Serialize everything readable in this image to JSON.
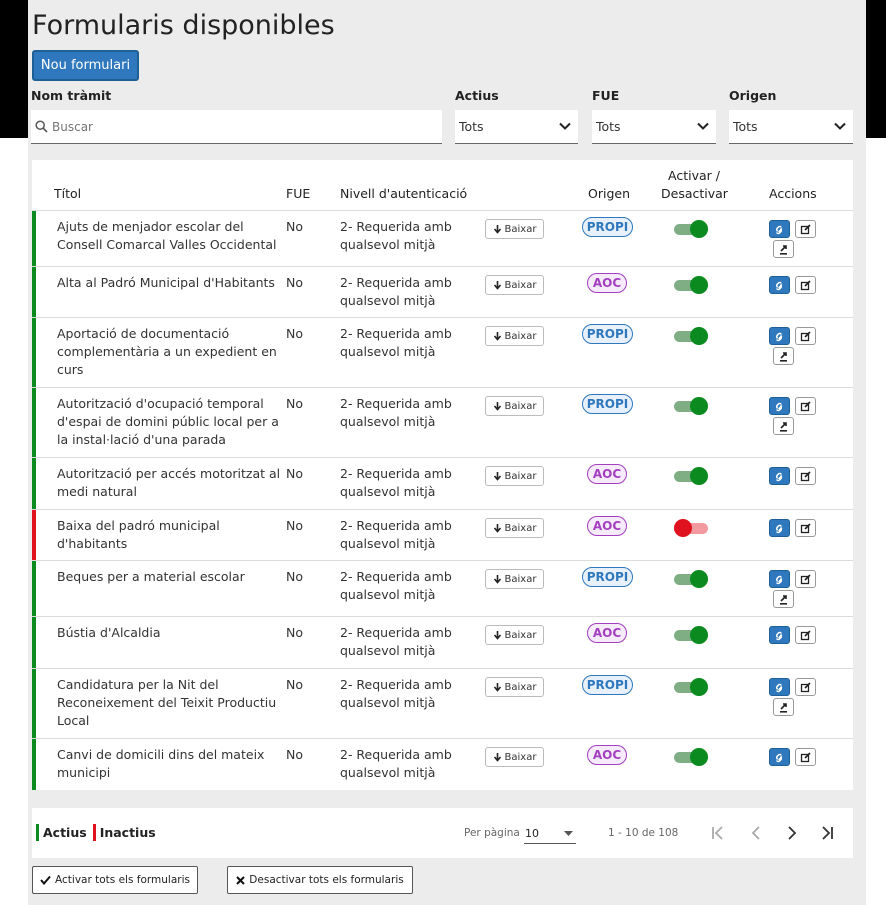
{
  "page": {
    "title": "Formularis disponibles",
    "new_button": "Nou formulari"
  },
  "filters": {
    "name_label": "Nom tràmit",
    "search_placeholder": "Buscar",
    "actius_label": "Actius",
    "actius_value": "Tots",
    "fue_label": "FUE",
    "fue_value": "Tots",
    "origen_label": "Origen",
    "origen_value": "Tots"
  },
  "table": {
    "headers": {
      "titol": "Títol",
      "fue": "FUE",
      "nivell": "Nivell d'autenticació",
      "origen": "Origen",
      "activar_1": "Activar /",
      "activar_2": "Desactivar",
      "accions": "Accions"
    },
    "download_label": "Baixar",
    "rows": [
      {
        "title_lines": [
          "Ajuts de menjador escolar del",
          "Consell Comarcal Valles Occidental"
        ],
        "fue": "No",
        "level_lines": [
          "2- Requerida amb",
          "qualsevol mitjà"
        ],
        "origin": "PROPI",
        "active": true,
        "extra_action": true
      },
      {
        "title_lines": [
          "Alta al Padró Municipal d'Habitants"
        ],
        "fue": "No",
        "level_lines": [
          "2- Requerida amb",
          "qualsevol mitjà"
        ],
        "origin": "AOC",
        "active": true,
        "extra_action": false
      },
      {
        "title_lines": [
          "Aportació de documentació",
          "complementària a un expedient en",
          "curs"
        ],
        "fue": "No",
        "level_lines": [
          "2- Requerida amb",
          "qualsevol mitjà"
        ],
        "origin": "PROPI",
        "active": true,
        "extra_action": true
      },
      {
        "title_lines": [
          "Autorització d'ocupació temporal",
          "d'espai de domini públic local per a",
          "la instal·lació d'una parada"
        ],
        "fue": "No",
        "level_lines": [
          "2- Requerida amb",
          "qualsevol mitjà"
        ],
        "origin": "PROPI",
        "active": true,
        "extra_action": true
      },
      {
        "title_lines": [
          "Autorització per accés motoritzat al",
          "medi natural"
        ],
        "fue": "No",
        "level_lines": [
          "2- Requerida amb",
          "qualsevol mitjà"
        ],
        "origin": "AOC",
        "active": true,
        "extra_action": false
      },
      {
        "title_lines": [
          "Baixa del padró municipal",
          "d'habitants"
        ],
        "fue": "No",
        "level_lines": [
          "2- Requerida amb",
          "qualsevol mitjà"
        ],
        "origin": "AOC",
        "active": false,
        "extra_action": false
      },
      {
        "title_lines": [
          "Beques per a material escolar"
        ],
        "fue": "No",
        "level_lines": [
          "2- Requerida amb",
          "qualsevol mitjà"
        ],
        "origin": "PROPI",
        "active": true,
        "extra_action": true
      },
      {
        "title_lines": [
          "Bústia d'Alcaldia"
        ],
        "fue": "No",
        "level_lines": [
          "2- Requerida amb",
          "qualsevol mitjà"
        ],
        "origin": "AOC",
        "active": true,
        "extra_action": false
      },
      {
        "title_lines": [
          "Candidatura per la Nit del",
          "Reconeixement del Teixit Productiu",
          "Local"
        ],
        "fue": "No",
        "level_lines": [
          "2- Requerida amb",
          "qualsevol mitjà"
        ],
        "origin": "PROPI",
        "active": true,
        "extra_action": true
      },
      {
        "title_lines": [
          "Canvi de domicili dins del mateix",
          "municipi"
        ],
        "fue": "No",
        "level_lines": [
          "2- Requerida amb",
          "qualsevol mitjà"
        ],
        "origin": "AOC",
        "active": true,
        "extra_action": false
      }
    ]
  },
  "footer": {
    "legend_active": "Actius",
    "legend_inactive": "Inactius",
    "per_page_label": "Per pàgina",
    "per_page_value": "10",
    "range_text": "1 - 10 de 108"
  },
  "bulk": {
    "activate_all": "Activar tots els formularis",
    "deactivate_all": "Desactivar tots els formularis"
  },
  "colors": {
    "active_green": "#0b8a1f",
    "inactive_red": "#e0121f",
    "propi_blue": "#2f78bd",
    "aoc_purple": "#a43fc0",
    "primary_blue": "#2f78bd"
  }
}
